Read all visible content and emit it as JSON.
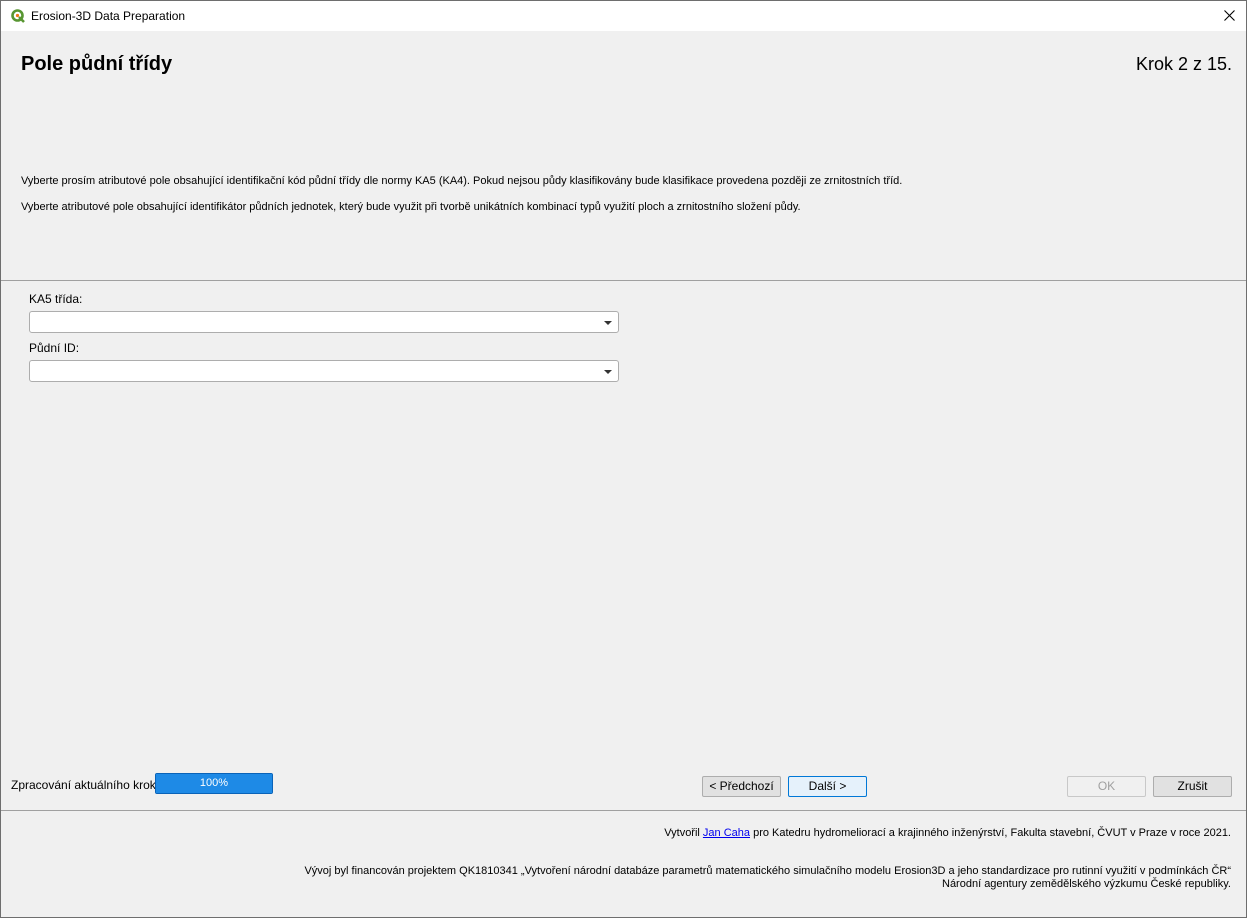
{
  "window": {
    "title": "Erosion-3D Data Preparation",
    "icon": "qgis-icon",
    "close_icon": "close-icon"
  },
  "header": {
    "title": "Pole půdní třídy",
    "step": "Krok 2 z 15.",
    "description_1": "Vyberte prosím atributové pole obsahující identifikační kód půdní třídy dle normy KA5 (KA4). Pokud nejsou půdy klasifikovány bude klasifikace provedena později ze zrnitostních tříd.",
    "description_2": "Vyberte atributové pole obsahující identifikátor půdních jednotek, který bude využit při tvorbě unikátních kombinací typů využití ploch a zrnitostního složení půdy."
  },
  "form": {
    "ka5_label": "KA5 třída:",
    "ka5_value": "",
    "soil_id_label": "Půdní ID:",
    "soil_id_value": ""
  },
  "progress": {
    "label": "Zpracování aktuálního kroku:",
    "value": 100,
    "text": "100%"
  },
  "buttons": {
    "previous": "< Předchozí",
    "next": "Další >",
    "ok": "OK",
    "cancel": "Zrušit"
  },
  "footer": {
    "created_prefix": "Vytvořil ",
    "author": "Jan Caha",
    "created_suffix": " pro Katedru hydromeliorací a krajinného inženýrství, Fakulta stavební, ČVUT v Praze v roce 2021.",
    "funding_line_1": "Vývoj byl financován projektem QK1810341 „Vytvoření národní databáze parametrů matematického simulačního modelu Erosion3D a jeho standardizace pro rutinní využití v podmínkách ČR“",
    "funding_line_2": "Národní agentury zemědělského výzkumu České republiky."
  },
  "colors": {
    "progress": "#0a84e4",
    "link": "#0000ee"
  }
}
